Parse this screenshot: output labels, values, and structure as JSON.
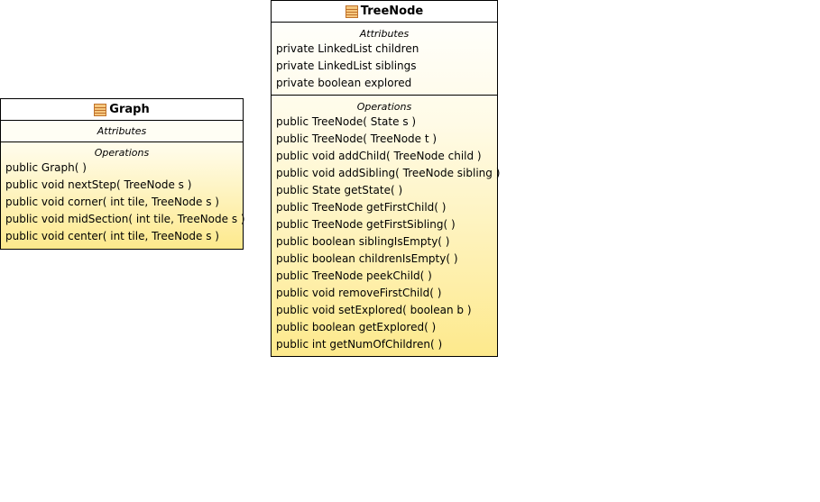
{
  "classes": {
    "graph": {
      "name": "Graph",
      "attributes_label": "Attributes",
      "operations_label": "Operations",
      "attributes": [],
      "operations": [
        "public Graph(  )",
        "public void  nextStep( TreeNode s )",
        "public void  corner( int tile, TreeNode s )",
        "public void  midSection( int tile, TreeNode s )",
        "public void  center( int tile, TreeNode s )"
      ]
    },
    "treenode": {
      "name": "TreeNode",
      "attributes_label": "Attributes",
      "operations_label": "Operations",
      "attributes": [
        "private LinkedList children",
        "private LinkedList siblings",
        "private boolean explored"
      ],
      "operations": [
        "public TreeNode( State s )",
        "public TreeNode( TreeNode t )",
        "public void  addChild( TreeNode child )",
        "public void  addSibling( TreeNode sibling )",
        "public State  getState(  )",
        "public TreeNode  getFirstChild(  )",
        "public TreeNode  getFirstSibling(  )",
        "public boolean  siblingIsEmpty(  )",
        "public boolean  childrenIsEmpty(  )",
        "public TreeNode  peekChild(  )",
        "public void  removeFirstChild(  )",
        "public void  setExplored( boolean b )",
        "public boolean  getExplored(  )",
        "public int  getNumOfChildren(  )"
      ]
    }
  },
  "icons": {
    "class_icon": "class-icon",
    "icon_fill": "#f5c77e",
    "icon_stroke": "#c0712a"
  }
}
